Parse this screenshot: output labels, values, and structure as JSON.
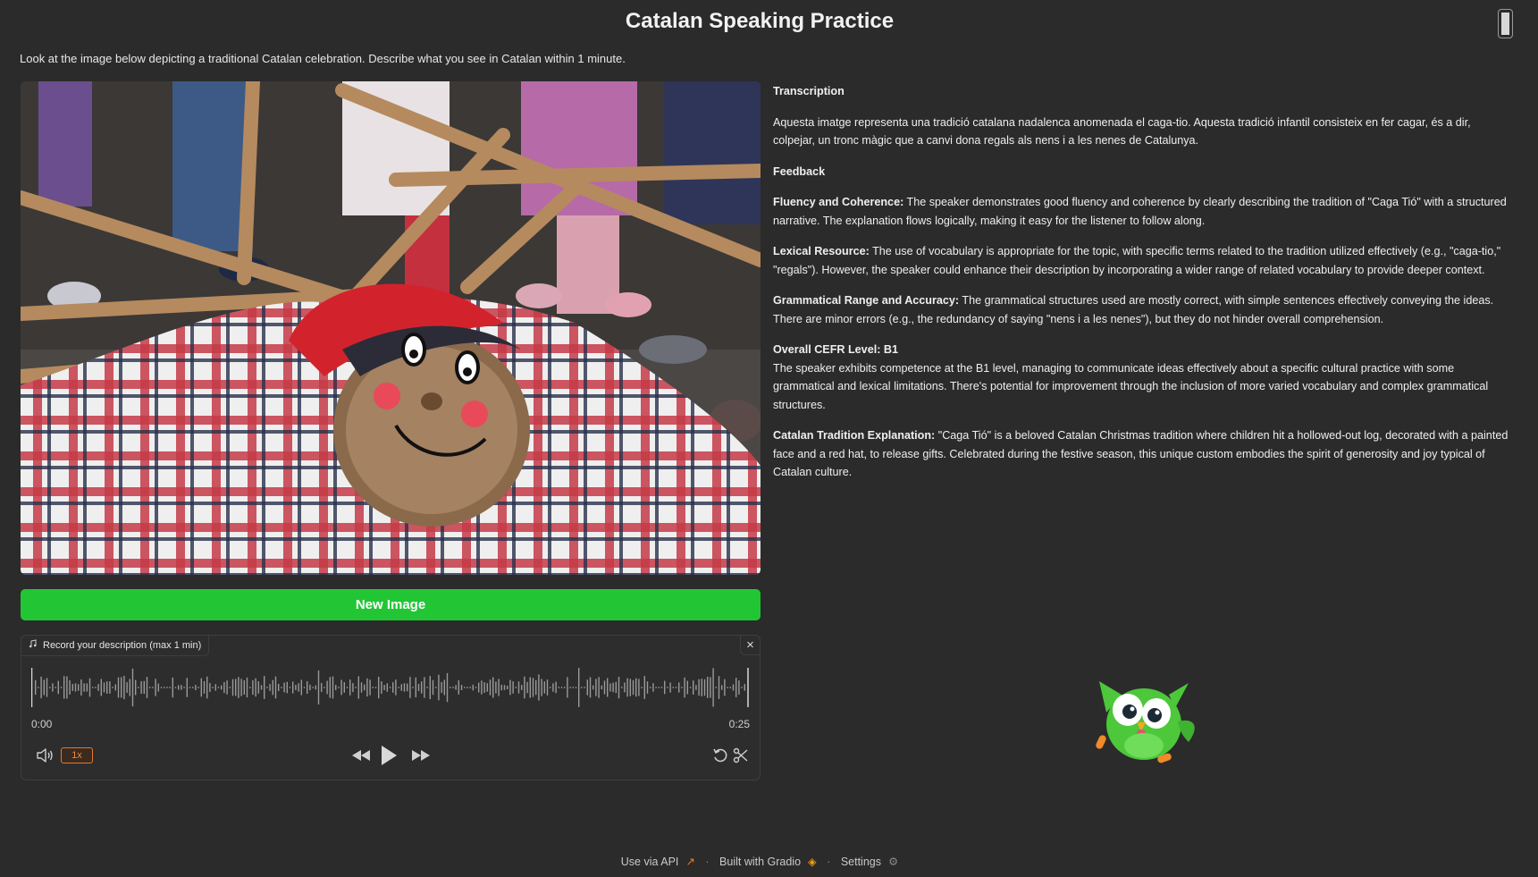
{
  "header": {
    "title": "Catalan Speaking Practice"
  },
  "instructions": "Look at the image below depicting a traditional Catalan celebration. Describe what you see in Catalan within 1 minute.",
  "buttons": {
    "new_image": "New Image"
  },
  "audio": {
    "label": "Record your description (max 1 min)",
    "label_icon": "music-note-icon",
    "time_start": "0:00",
    "time_end": "0:25",
    "speed": "1x",
    "controls": [
      "volume-icon",
      "rewind-icon",
      "play-icon",
      "fast-forward-icon",
      "undo-icon",
      "scissors-icon"
    ]
  },
  "feedback": {
    "transcription_heading": "Transcription",
    "transcription_text": "Aquesta imatge representa una tradició catalana nadalenca anomenada el caga-tio. Aquesta tradició infantil consisteix en fer cagar, és a dir, colpejar, un tronc màgic que a canvi dona regals als nens i a les nenes de Catalunya.",
    "feedback_heading": "Feedback",
    "fluency_label": "Fluency and Coherence:",
    "fluency_text": " The speaker demonstrates good fluency and coherence by clearly describing the tradition of \"Caga Tió\" with a structured narrative. The explanation flows logically, making it easy for the listener to follow along.",
    "lexical_label": "Lexical Resource:",
    "lexical_text": " The use of vocabulary is appropriate for the topic, with specific terms related to the tradition utilized effectively (e.g., \"caga-tio,\" \"regals\"). However, the speaker could enhance their description by incorporating a wider range of related vocabulary to provide deeper context.",
    "grammar_label": "Grammatical Range and Accuracy:",
    "grammar_text": " The grammatical structures used are mostly correct, with simple sentences effectively conveying the ideas. There are minor errors (e.g., the redundancy of saying \"nens i a les nenes\"), but they do not hinder overall comprehension.",
    "cefr_label": "Overall CEFR Level: B1",
    "cefr_text": "The speaker exhibits competence at the B1 level, managing to communicate ideas effectively about a specific cultural practice with some grammatical and lexical limitations. There's potential for improvement through the inclusion of more varied vocabulary and complex grammatical structures.",
    "tradition_label": "Catalan Tradition Explanation:",
    "tradition_text": " \"Caga Tió\" is a beloved Catalan Christmas tradition where children hit a hollowed-out log, decorated with a painted face and a red hat, to release gifts. Celebrated during the festive season, this unique custom embodies the spirit of generosity and joy typical of Catalan culture."
  },
  "footer": {
    "api": "Use via API",
    "built": "Built with Gradio",
    "settings": "Settings",
    "separator": "·"
  },
  "colors": {
    "background": "#2b2b2b",
    "primary_button": "#22c635",
    "speed_accent": "#e8772a",
    "mascot_green": "#4cc83a"
  }
}
